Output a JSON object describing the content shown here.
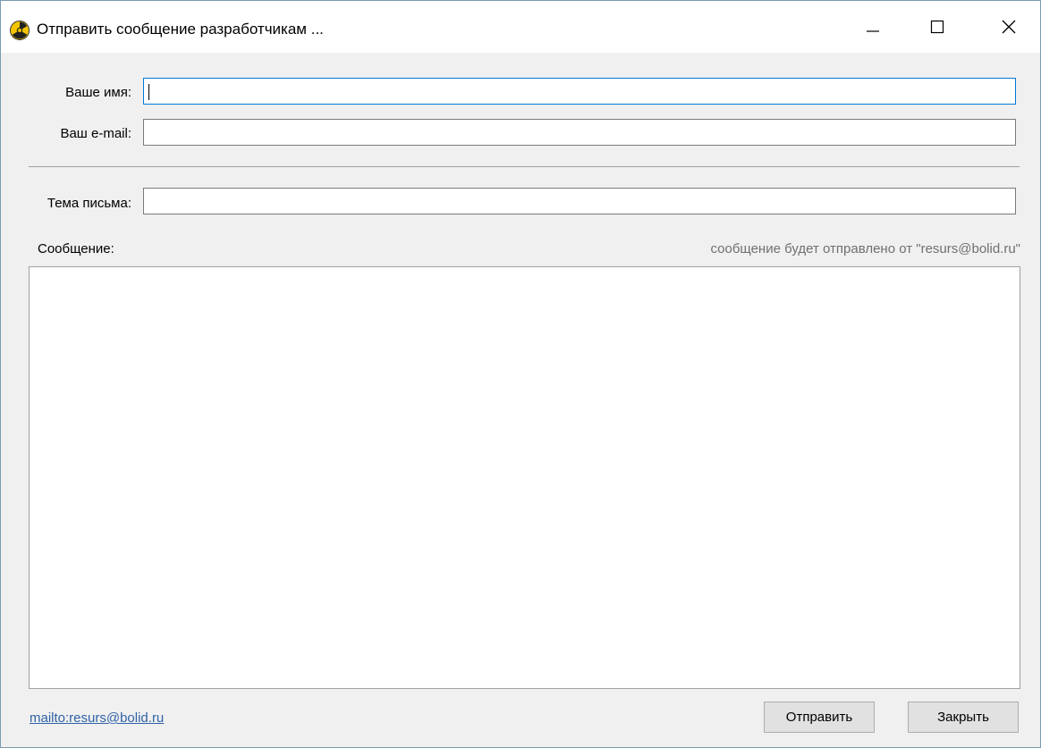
{
  "window": {
    "title": "Отправить сообщение разработчикам ...",
    "icon": "radiation-icon"
  },
  "form": {
    "name_label": "Ваше имя:",
    "name_value": "",
    "email_label": "Ваш e-mail:",
    "email_value": "",
    "subject_label": "Тема письма:",
    "subject_value": "",
    "message_label": "Сообщение:",
    "sender_hint": "сообщение будет отправлено от \"resurs@bolid.ru\"",
    "message_value": ""
  },
  "footer": {
    "mailto_link": "mailto:resurs@bolid.ru",
    "send_label": "Отправить",
    "close_label": "Закрыть"
  },
  "colors": {
    "focus_border": "#0078d7",
    "link": "#3062a8",
    "hint_text": "#707070"
  }
}
